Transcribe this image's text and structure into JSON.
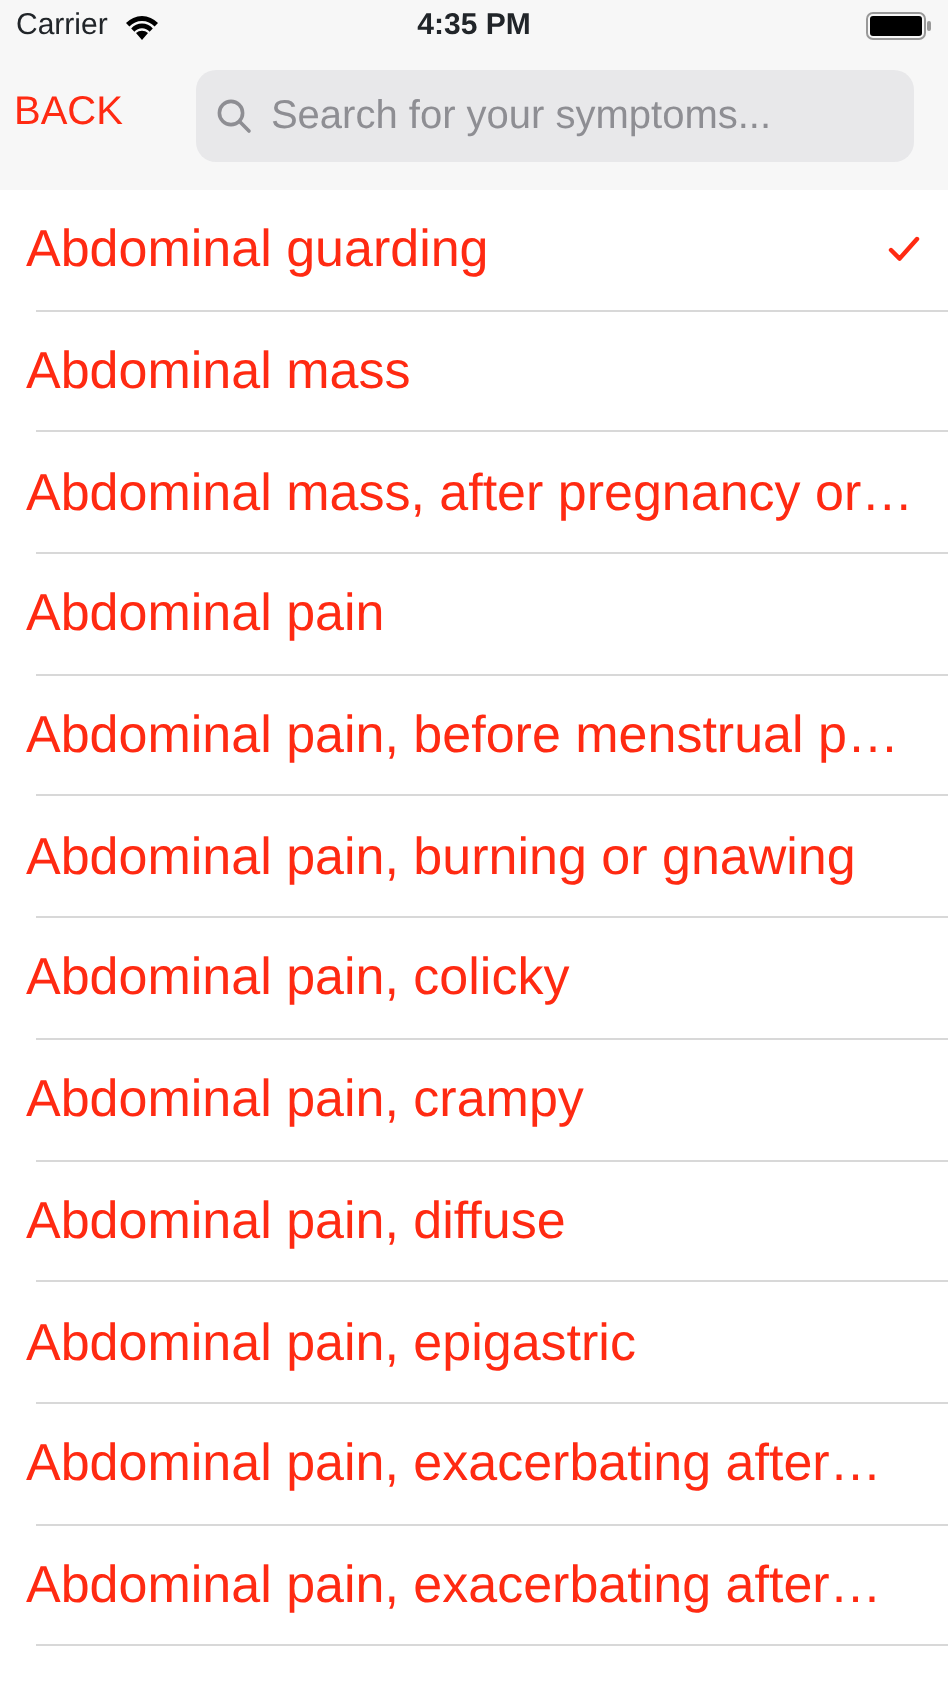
{
  "status_bar": {
    "carrier": "Carrier",
    "time": "4:35 PM"
  },
  "nav": {
    "back": "BACK",
    "search": {
      "placeholder": "Search for your symptoms..."
    }
  },
  "symptoms": [
    {
      "label": "Abdominal guarding",
      "selected": true
    },
    {
      "label": "Abdominal mass",
      "selected": false
    },
    {
      "label": "Abdominal mass, after pregnancy or…",
      "selected": false
    },
    {
      "label": "Abdominal pain",
      "selected": false
    },
    {
      "label": "Abdominal pain, before menstrual p…",
      "selected": false
    },
    {
      "label": "Abdominal pain, burning or gnawing",
      "selected": false
    },
    {
      "label": "Abdominal pain, colicky",
      "selected": false
    },
    {
      "label": "Abdominal pain, crampy",
      "selected": false
    },
    {
      "label": "Abdominal pain, diffuse",
      "selected": false
    },
    {
      "label": "Abdominal pain, epigastric",
      "selected": false
    },
    {
      "label": "Abdominal pain, exacerbating after…",
      "selected": false
    },
    {
      "label": "Abdominal pain, exacerbating after…",
      "selected": false
    }
  ]
}
